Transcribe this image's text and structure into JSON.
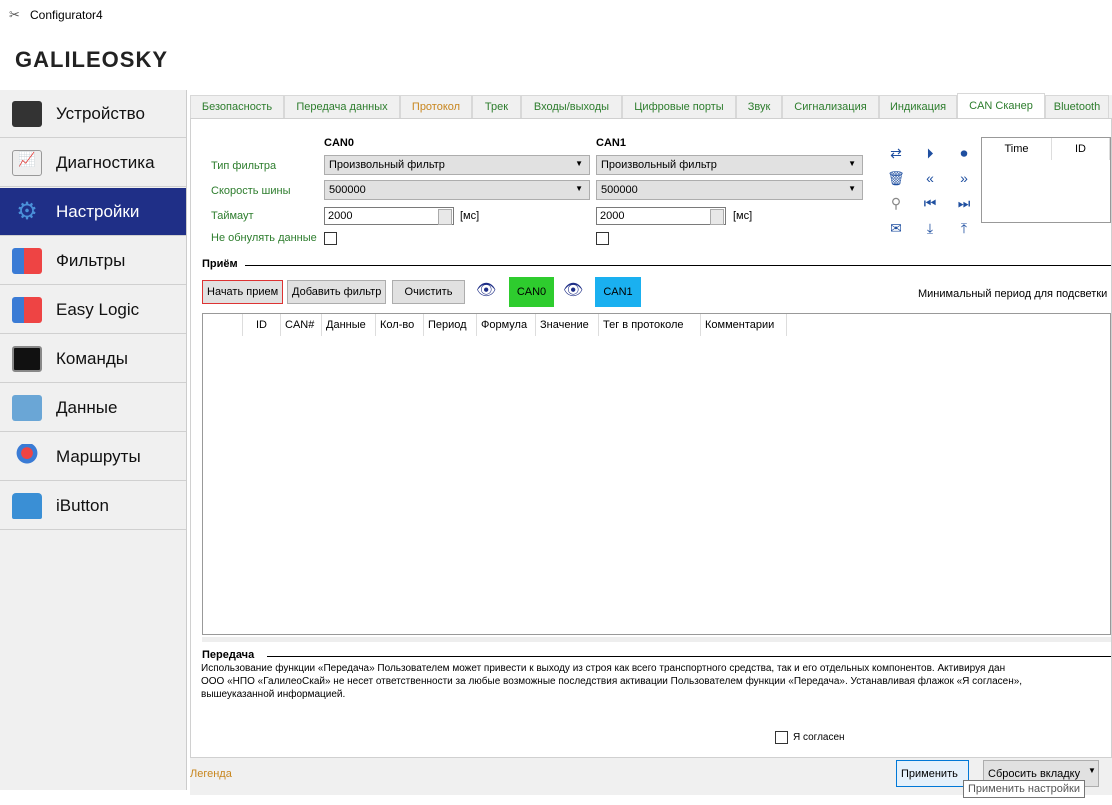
{
  "window": {
    "title": "Configurator4",
    "logo": "GALILEOSKY"
  },
  "sidebar": {
    "items": [
      {
        "label": "Устройство",
        "icon": "device-icon"
      },
      {
        "label": "Диагностика",
        "icon": "diagnostics-chart-icon"
      },
      {
        "label": "Настройки",
        "icon": "gear-icon",
        "active": true
      },
      {
        "label": "Фильтры",
        "icon": "filters-icon"
      },
      {
        "label": "Easy Logic",
        "icon": "easy-logic-icon"
      },
      {
        "label": "Команды",
        "icon": "terminal-icon"
      },
      {
        "label": "Данные",
        "icon": "data-disk-icon"
      },
      {
        "label": "Маршруты",
        "icon": "map-pin-icon"
      },
      {
        "label": "iButton",
        "icon": "lock-icon"
      }
    ]
  },
  "tabs": [
    "Безопасность",
    "Передача данных",
    "Протокол",
    "Трек",
    "Входы/выходы",
    "Цифровые порты",
    "Звук",
    "Сигнализация",
    "Индикация",
    "CAN Сканер",
    "Bluetooth"
  ],
  "active_tab": "CAN Сканер",
  "can": {
    "col0": "CAN0",
    "col1": "CAN1",
    "filter_type_label": "Тип фильтра",
    "bus_speed_label": "Скорость шины",
    "timeout_label": "Таймаут",
    "no_reset_label": "Не обнулять данные",
    "can0": {
      "filter_type": "Произвольный фильтр",
      "bus_speed": "500000",
      "timeout": "2000",
      "no_reset": false
    },
    "can1": {
      "filter_type": "Произвольный фильтр",
      "bus_speed": "500000",
      "timeout": "2000",
      "no_reset": false
    },
    "unit": "[мс]"
  },
  "log_table": {
    "headers": [
      "Time",
      "ID"
    ]
  },
  "receive": {
    "title": "Приём",
    "start": "Начать прием",
    "add_filter": "Добавить фильтр",
    "clear": "Очистить",
    "can0": "CAN0",
    "can1": "CAN1",
    "can0_color": "#2ecc2e",
    "can1_color": "#1ab0f0",
    "min_period": "Минимальный период для подсветки",
    "headers": [
      "ID",
      "CAN#",
      "Данные",
      "Кол-во",
      "Период",
      "Формула",
      "Значение",
      "Тег в протоколе",
      "Комментарии"
    ]
  },
  "transmit": {
    "title": "Передача",
    "lines": [
      "Использование функции «Передача» Пользователем может привести к выходу из строя как всего транспортного средства, так и его отдельных компонентов. Активируя дан",
      "ООО «НПО «ГалилеоСкай» не несет ответственности за любые возможные последствия активации Пользователем функции «Передача». Устанавливая флажок «Я согласен»,",
      "вышеуказанной информацией."
    ],
    "agree": "Я согласен"
  },
  "footer": {
    "legend": "Легенда",
    "apply": "Применить",
    "reset_tab": "Сбросить вкладку",
    "tooltip": "Применить настройки"
  }
}
